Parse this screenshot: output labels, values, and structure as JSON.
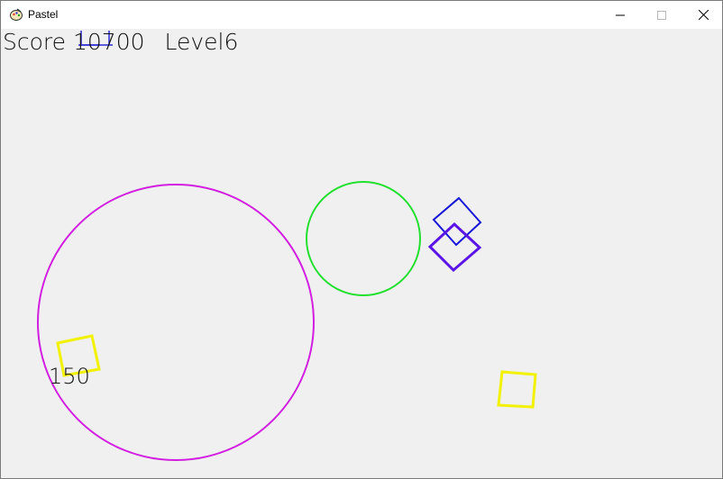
{
  "window": {
    "title": "Pastel",
    "app_icon": "pastel-app-icon",
    "controls": {
      "minimize_icon": "minimize-icon",
      "maximize_icon": "maximize-icon",
      "close_icon": "close-icon"
    }
  },
  "hud": {
    "score_label": "Score",
    "score_value": "10700",
    "level_label": "Level",
    "level_value": "6"
  },
  "floating_points": "150",
  "colors": {
    "big_circle": "#d21ee0",
    "green_circle": "#22e02e",
    "blue_diamond": "#1616d8",
    "purple_diamond": "#5a14e6",
    "yellow_square": "#f2f200",
    "cursor_marker": "#2b2bd4",
    "background": "#f0f0f0"
  },
  "objects": [
    {
      "name": "big-magenta-circle",
      "type": "circle",
      "color": "big_circle"
    },
    {
      "name": "green-circle",
      "type": "circle",
      "color": "green_circle"
    },
    {
      "name": "blue-diamond",
      "type": "diamond",
      "color": "blue_diamond"
    },
    {
      "name": "purple-diamond",
      "type": "diamond",
      "color": "purple_diamond"
    },
    {
      "name": "yellow-square-left",
      "type": "square",
      "color": "yellow_square"
    },
    {
      "name": "yellow-square-right",
      "type": "square",
      "color": "yellow_square"
    }
  ]
}
